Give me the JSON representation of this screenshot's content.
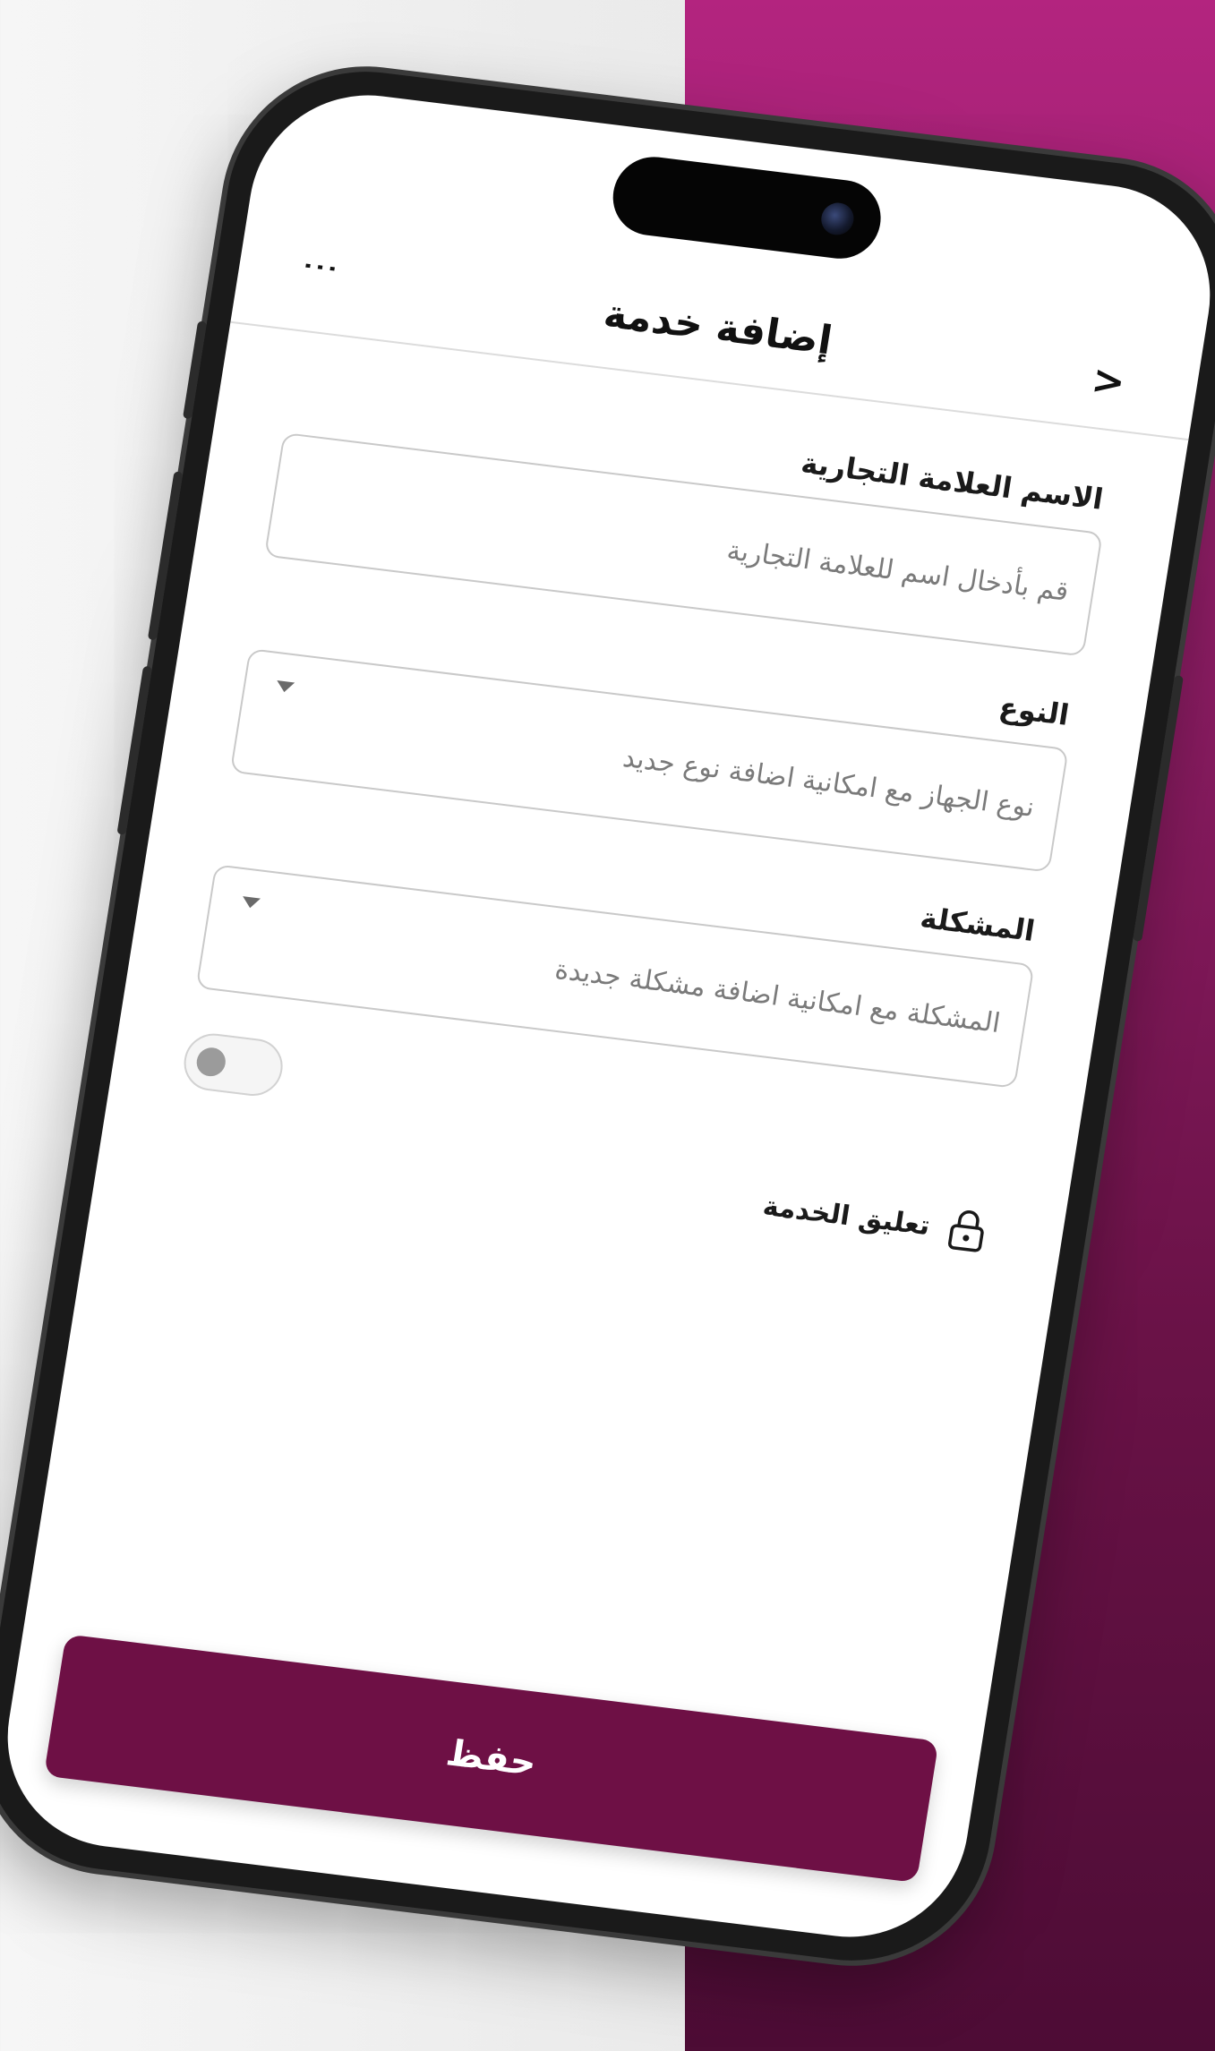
{
  "header": {
    "title": "إضافة خدمة",
    "back_glyph": ">",
    "menu_glyph": "⋮"
  },
  "form": {
    "brand": {
      "label": "الاسم العلامة التجارية",
      "placeholder": "قم بأدخال اسم للعلامة التجارية"
    },
    "type": {
      "label": "النوع",
      "placeholder": "نوع الجهاز مع امكانية اضافة نوع جديد"
    },
    "problem": {
      "label": "المشكلة",
      "placeholder": "المشكلة مع امكانية اضافة مشكلة جديدة"
    },
    "suspend": {
      "label": "تعليق الخدمة",
      "toggle_on": false
    }
  },
  "actions": {
    "save_label": "حفظ"
  },
  "colors": {
    "accent": "#6e1045",
    "bg_purple_top": "#b3247f",
    "bg_purple_bottom": "#4d0c35"
  },
  "icons": {
    "menu": "kebab-menu-icon",
    "back": "chevron-right-icon",
    "dropdown": "caret-down-icon",
    "lock": "lock-icon"
  }
}
